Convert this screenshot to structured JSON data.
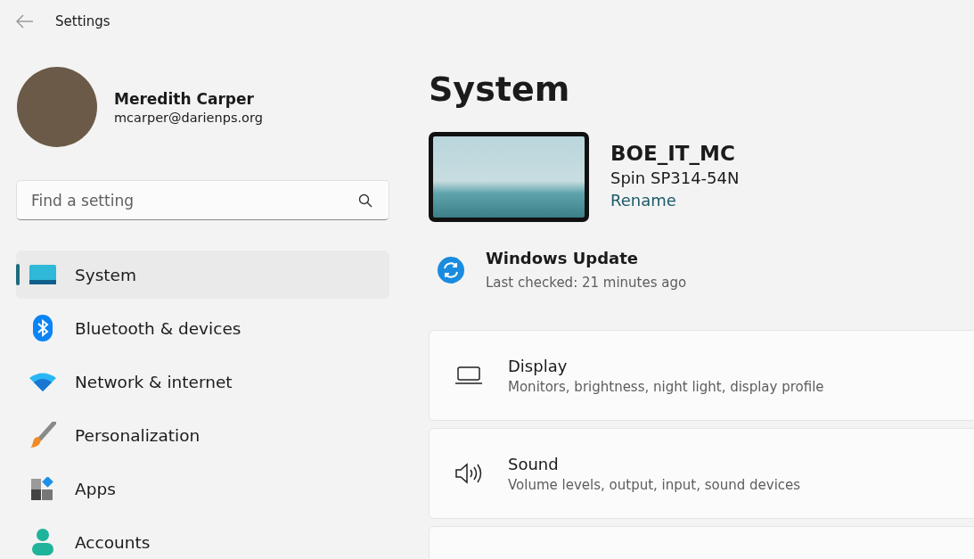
{
  "window": {
    "title": "Settings"
  },
  "profile": {
    "name": "Meredith Carper",
    "email": "mcarper@darienps.org"
  },
  "search": {
    "placeholder": "Find a setting"
  },
  "sidebar": {
    "items": [
      {
        "label": "System",
        "kind": "system",
        "selected": true
      },
      {
        "label": "Bluetooth & devices",
        "kind": "bluetooth",
        "selected": false
      },
      {
        "label": "Network & internet",
        "kind": "network",
        "selected": false
      },
      {
        "label": "Personalization",
        "kind": "personalization",
        "selected": false
      },
      {
        "label": "Apps",
        "kind": "apps",
        "selected": false
      },
      {
        "label": "Accounts",
        "kind": "accounts",
        "selected": false
      }
    ]
  },
  "page_title": "System",
  "device": {
    "name": "BOE_IT_MC",
    "model": "Spin SP314-54N",
    "rename_link": "Rename"
  },
  "update": {
    "title": "Windows Update",
    "status": "Last checked: 21 minutes ago"
  },
  "cards": [
    {
      "kind": "display",
      "title": "Display",
      "subtitle": "Monitors, brightness, night light, display profile"
    },
    {
      "kind": "sound",
      "title": "Sound",
      "subtitle": "Volume levels, output, input, sound devices"
    }
  ]
}
